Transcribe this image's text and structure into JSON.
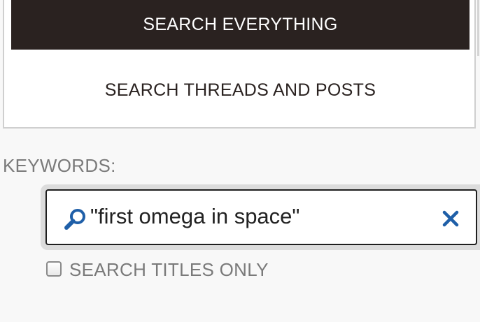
{
  "tabs": {
    "active_label": "SEARCH EVERYTHING",
    "inactive_label": "SEARCH THREADS AND POSTS"
  },
  "keywords": {
    "label": "KEYWORDS:",
    "value": "\"first omega in space\"",
    "search_icon": "search-icon",
    "clear_icon": "close-icon"
  },
  "options": {
    "titles_only_label": "SEARCH TITLES ONLY",
    "titles_only_checked": false
  },
  "colors": {
    "active_tab_bg": "#2a2220",
    "icon_blue": "#1f5fa8",
    "muted_text": "#7a7a7a"
  }
}
